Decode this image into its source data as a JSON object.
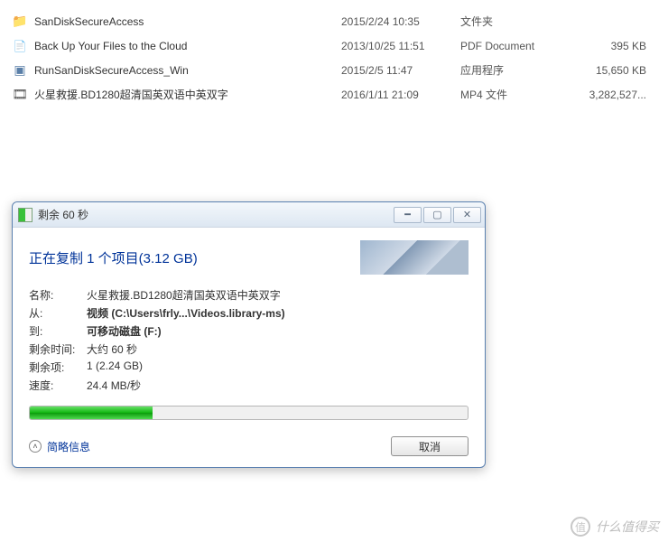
{
  "files": [
    {
      "icon": "folder",
      "name": "SanDiskSecureAccess",
      "date": "2015/2/24 10:35",
      "type": "文件夹",
      "size": ""
    },
    {
      "icon": "pdf",
      "name": "Back Up Your Files to the Cloud",
      "date": "2013/10/25 11:51",
      "type": "PDF Document",
      "size": "395 KB"
    },
    {
      "icon": "exe",
      "name": "RunSanDiskSecureAccess_Win",
      "date": "2015/2/5 11:47",
      "type": "应用程序",
      "size": "15,650 KB"
    },
    {
      "icon": "mp4",
      "name": "火星救援.BD1280超清国英双语中英双字",
      "date": "2016/1/11 21:09",
      "type": "MP4 文件",
      "size": "3,282,527..."
    }
  ],
  "dialog": {
    "title": "剩余 60 秒",
    "heading": "正在复制 1 个项目(3.12 GB)",
    "labels": {
      "name": "名称:",
      "from": "从:",
      "to": "到:",
      "remain": "剩余时间:",
      "items": "剩余项:",
      "speed": "速度:"
    },
    "values": {
      "name": "火星救援.BD1280超清国英双语中英双字",
      "from": "视频 (C:\\Users\\frly...\\Videos.library-ms)",
      "to": "可移动磁盘 (F:)",
      "remain": "大约 60 秒",
      "items": "1 (2.24 GB)",
      "speed": "24.4 MB/秒"
    },
    "less_info": "简略信息",
    "cancel": "取消"
  },
  "watermark": "什么值得买"
}
